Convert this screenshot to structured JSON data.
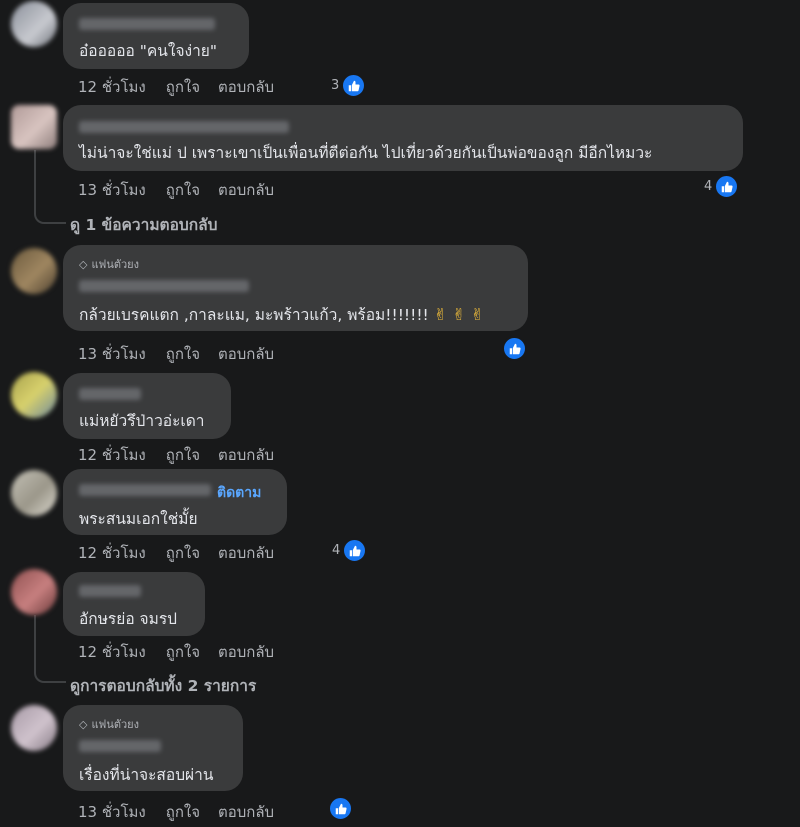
{
  "actions": {
    "like": "ถูกใจ",
    "reply": "ตอบกลับ"
  },
  "fan_badge": "แฟนตัวยง",
  "follow_label": "ติดตาม",
  "comments": [
    {
      "text": "อ๋อออออ \"คนใจง่าย\"",
      "time": "12 ชั่วโมง",
      "reactions": "3"
    },
    {
      "text": "ไม่น่าจะใช่แม่ ป เพราะเขาเป็นเพื่อนที่ตีต่อกัน ไปเที่ยวด้วยกันเป็นพ่อของลูก มีอีกไหมวะ",
      "time": "13 ชั่วโมง",
      "reactions": "4",
      "view_replies": "ดู 1 ข้อความตอบกลับ"
    },
    {
      "text": "กล้วยเบรคแตก ,กาละแม, มะพร้าวแก้ว, พร้อม!!!!!!!",
      "emoji": "✌ ✌ ✌",
      "time": "13 ชั่วโมง",
      "reactions": ""
    },
    {
      "text": "แม่หยัวรึป่าวอ่ะเดา",
      "time": "12 ชั่วโมง",
      "reactions": ""
    },
    {
      "text": "พระสนมเอกใช่มั้ย",
      "time": "12 ชั่วโมง",
      "reactions": "4"
    },
    {
      "text": "อักษรย่อ จมรป",
      "time": "12 ชั่วโมง",
      "reactions": "",
      "view_replies": "ดูการตอบกลับทั้ง 2 รายการ"
    },
    {
      "text": "เรื่องที่น่าจะสอบผ่าน",
      "time": "13 ชั่วโมง",
      "reactions": ""
    }
  ],
  "colors": {
    "background": "#18191a",
    "bubble": "#3a3b3c",
    "like_blue": "#1877f2",
    "follow_blue": "#5aa7ff"
  }
}
